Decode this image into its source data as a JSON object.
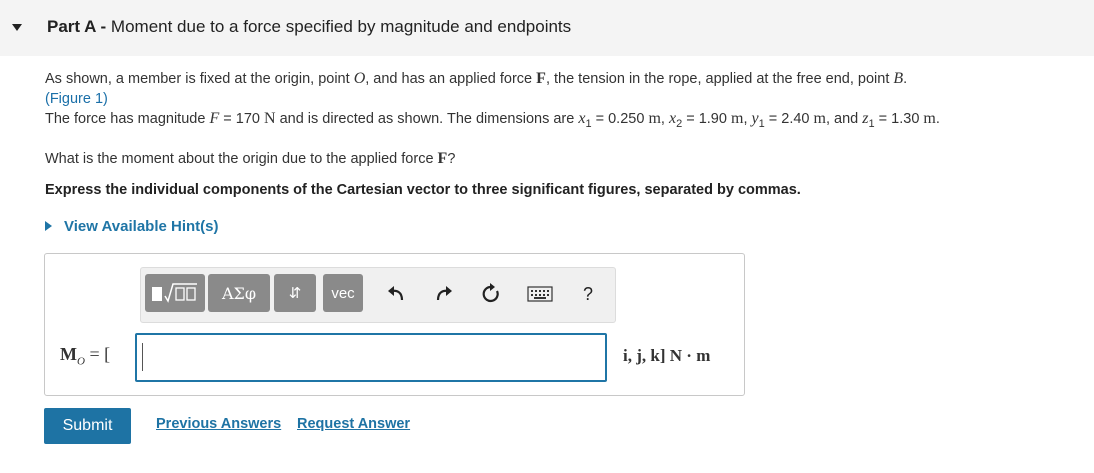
{
  "part": {
    "label": "Part A",
    "separator": " - ",
    "title": "Moment due to a force specified by magnitude and endpoints"
  },
  "problem": {
    "line1_prefix": "As shown, a member is fixed at the origin, point ",
    "point_o": "O",
    "line1_mid": ", and has an applied force ",
    "force_symbol": "F",
    "line1_suffix": ", the tension in the rope, applied at the free end, point ",
    "point_b": "B",
    "line1_end": ".",
    "figure_link": "(Figure 1)",
    "line3_prefix": "The force has magnitude ",
    "f_italic": "F",
    "eq": " = ",
    "f_value": "170",
    "f_unit": "N",
    "line3_mid": " and is directed as shown. The dimensions are ",
    "x1_var": "x",
    "x1_sub": "1",
    "x1_value": "0.250",
    "m_unit": "m",
    "comma": ", ",
    "x2_var": "x",
    "x2_sub": "2",
    "x2_value": "1.90",
    "y1_var": "y",
    "y1_sub": "1",
    "y1_value": "2.40",
    "and_text": ", and ",
    "z1_var": "z",
    "z1_sub": "1",
    "z1_value": "1.30",
    "period": ".",
    "question_prefix": "What is the moment about the origin due to the applied force ",
    "question_force": "F",
    "question_suffix": "?",
    "instruction": "Express the individual components of the Cartesian vector to three significant figures, separated by commas."
  },
  "hints": {
    "label": "View Available Hint(s)"
  },
  "toolbar": {
    "greek_label": "ΑΣφ",
    "updown_label": "⇵",
    "vec_label": "vec",
    "help_label": "?",
    "icons": [
      "templates-icon",
      "greek-icon",
      "subscript-icon",
      "vec-icon",
      "undo-icon",
      "redo-icon",
      "reset-icon",
      "keyboard-icon",
      "help-icon"
    ]
  },
  "answer": {
    "mo_symbol": "M",
    "mo_sub": "O",
    "mo_eq": " = [",
    "value": "",
    "units": "i, j, k] N · m"
  },
  "actions": {
    "submit": "Submit",
    "previous": "Previous Answers",
    "request": "Request Answer"
  },
  "colors": {
    "accent": "#1e73a4",
    "header_bg": "#f4f4f4"
  }
}
